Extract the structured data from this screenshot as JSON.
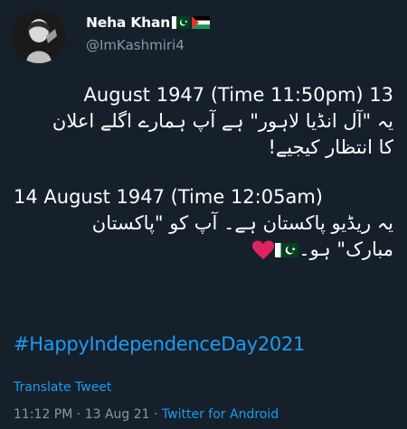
{
  "author": {
    "display_name": "Neha Khan",
    "handle": "@ImKashmiri4",
    "flags": [
      "pakistan-flag-icon",
      "palestine-flag-icon"
    ]
  },
  "tweet": {
    "line1": "August 1947 (Time 11:50pm) 13",
    "line2": "یہ \"آل انڈیا لاہور\" ہے آپ ہمارے اگلے اعلان",
    "line3": "کا انتظار کیجیے!",
    "line4": "14 August 1947 (Time 12:05am)",
    "line5": "یہ ریڈیو پاکستان ہے۔ آپ کو \"پاکستان",
    "line6": "مبارک\" ہو۔",
    "line6_icons": [
      "pakistan-flag-icon",
      "red-heart-icon"
    ],
    "hashtag": "#HappyIndependenceDay2021"
  },
  "translate_label": "Translate Tweet",
  "meta": {
    "time": "11:12 PM",
    "separator1": " · ",
    "date": "13 Aug 21",
    "separator2": " · ",
    "source": "Twitter for Android"
  },
  "colors": {
    "background": "#15202b",
    "text": "#ffffff",
    "secondary": "#8899a6",
    "link": "#1d9bf0",
    "heart": "#e0245e"
  }
}
